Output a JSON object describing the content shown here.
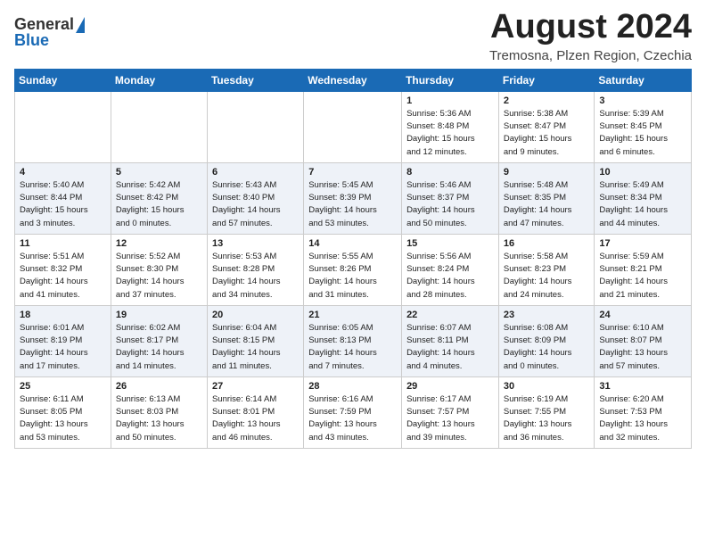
{
  "header": {
    "logo_general": "General",
    "logo_blue": "Blue",
    "main_title": "August 2024",
    "subtitle": "Tremosna, Plzen Region, Czechia"
  },
  "days_of_week": [
    "Sunday",
    "Monday",
    "Tuesday",
    "Wednesday",
    "Thursday",
    "Friday",
    "Saturday"
  ],
  "weeks": [
    [
      {
        "day": "",
        "info": ""
      },
      {
        "day": "",
        "info": ""
      },
      {
        "day": "",
        "info": ""
      },
      {
        "day": "",
        "info": ""
      },
      {
        "day": "1",
        "info": "Sunrise: 5:36 AM\nSunset: 8:48 PM\nDaylight: 15 hours\nand 12 minutes."
      },
      {
        "day": "2",
        "info": "Sunrise: 5:38 AM\nSunset: 8:47 PM\nDaylight: 15 hours\nand 9 minutes."
      },
      {
        "day": "3",
        "info": "Sunrise: 5:39 AM\nSunset: 8:45 PM\nDaylight: 15 hours\nand 6 minutes."
      }
    ],
    [
      {
        "day": "4",
        "info": "Sunrise: 5:40 AM\nSunset: 8:44 PM\nDaylight: 15 hours\nand 3 minutes."
      },
      {
        "day": "5",
        "info": "Sunrise: 5:42 AM\nSunset: 8:42 PM\nDaylight: 15 hours\nand 0 minutes."
      },
      {
        "day": "6",
        "info": "Sunrise: 5:43 AM\nSunset: 8:40 PM\nDaylight: 14 hours\nand 57 minutes."
      },
      {
        "day": "7",
        "info": "Sunrise: 5:45 AM\nSunset: 8:39 PM\nDaylight: 14 hours\nand 53 minutes."
      },
      {
        "day": "8",
        "info": "Sunrise: 5:46 AM\nSunset: 8:37 PM\nDaylight: 14 hours\nand 50 minutes."
      },
      {
        "day": "9",
        "info": "Sunrise: 5:48 AM\nSunset: 8:35 PM\nDaylight: 14 hours\nand 47 minutes."
      },
      {
        "day": "10",
        "info": "Sunrise: 5:49 AM\nSunset: 8:34 PM\nDaylight: 14 hours\nand 44 minutes."
      }
    ],
    [
      {
        "day": "11",
        "info": "Sunrise: 5:51 AM\nSunset: 8:32 PM\nDaylight: 14 hours\nand 41 minutes."
      },
      {
        "day": "12",
        "info": "Sunrise: 5:52 AM\nSunset: 8:30 PM\nDaylight: 14 hours\nand 37 minutes."
      },
      {
        "day": "13",
        "info": "Sunrise: 5:53 AM\nSunset: 8:28 PM\nDaylight: 14 hours\nand 34 minutes."
      },
      {
        "day": "14",
        "info": "Sunrise: 5:55 AM\nSunset: 8:26 PM\nDaylight: 14 hours\nand 31 minutes."
      },
      {
        "day": "15",
        "info": "Sunrise: 5:56 AM\nSunset: 8:24 PM\nDaylight: 14 hours\nand 28 minutes."
      },
      {
        "day": "16",
        "info": "Sunrise: 5:58 AM\nSunset: 8:23 PM\nDaylight: 14 hours\nand 24 minutes."
      },
      {
        "day": "17",
        "info": "Sunrise: 5:59 AM\nSunset: 8:21 PM\nDaylight: 14 hours\nand 21 minutes."
      }
    ],
    [
      {
        "day": "18",
        "info": "Sunrise: 6:01 AM\nSunset: 8:19 PM\nDaylight: 14 hours\nand 17 minutes."
      },
      {
        "day": "19",
        "info": "Sunrise: 6:02 AM\nSunset: 8:17 PM\nDaylight: 14 hours\nand 14 minutes."
      },
      {
        "day": "20",
        "info": "Sunrise: 6:04 AM\nSunset: 8:15 PM\nDaylight: 14 hours\nand 11 minutes."
      },
      {
        "day": "21",
        "info": "Sunrise: 6:05 AM\nSunset: 8:13 PM\nDaylight: 14 hours\nand 7 minutes."
      },
      {
        "day": "22",
        "info": "Sunrise: 6:07 AM\nSunset: 8:11 PM\nDaylight: 14 hours\nand 4 minutes."
      },
      {
        "day": "23",
        "info": "Sunrise: 6:08 AM\nSunset: 8:09 PM\nDaylight: 14 hours\nand 0 minutes."
      },
      {
        "day": "24",
        "info": "Sunrise: 6:10 AM\nSunset: 8:07 PM\nDaylight: 13 hours\nand 57 minutes."
      }
    ],
    [
      {
        "day": "25",
        "info": "Sunrise: 6:11 AM\nSunset: 8:05 PM\nDaylight: 13 hours\nand 53 minutes."
      },
      {
        "day": "26",
        "info": "Sunrise: 6:13 AM\nSunset: 8:03 PM\nDaylight: 13 hours\nand 50 minutes."
      },
      {
        "day": "27",
        "info": "Sunrise: 6:14 AM\nSunset: 8:01 PM\nDaylight: 13 hours\nand 46 minutes."
      },
      {
        "day": "28",
        "info": "Sunrise: 6:16 AM\nSunset: 7:59 PM\nDaylight: 13 hours\nand 43 minutes."
      },
      {
        "day": "29",
        "info": "Sunrise: 6:17 AM\nSunset: 7:57 PM\nDaylight: 13 hours\nand 39 minutes."
      },
      {
        "day": "30",
        "info": "Sunrise: 6:19 AM\nSunset: 7:55 PM\nDaylight: 13 hours\nand 36 minutes."
      },
      {
        "day": "31",
        "info": "Sunrise: 6:20 AM\nSunset: 7:53 PM\nDaylight: 13 hours\nand 32 minutes."
      }
    ]
  ]
}
